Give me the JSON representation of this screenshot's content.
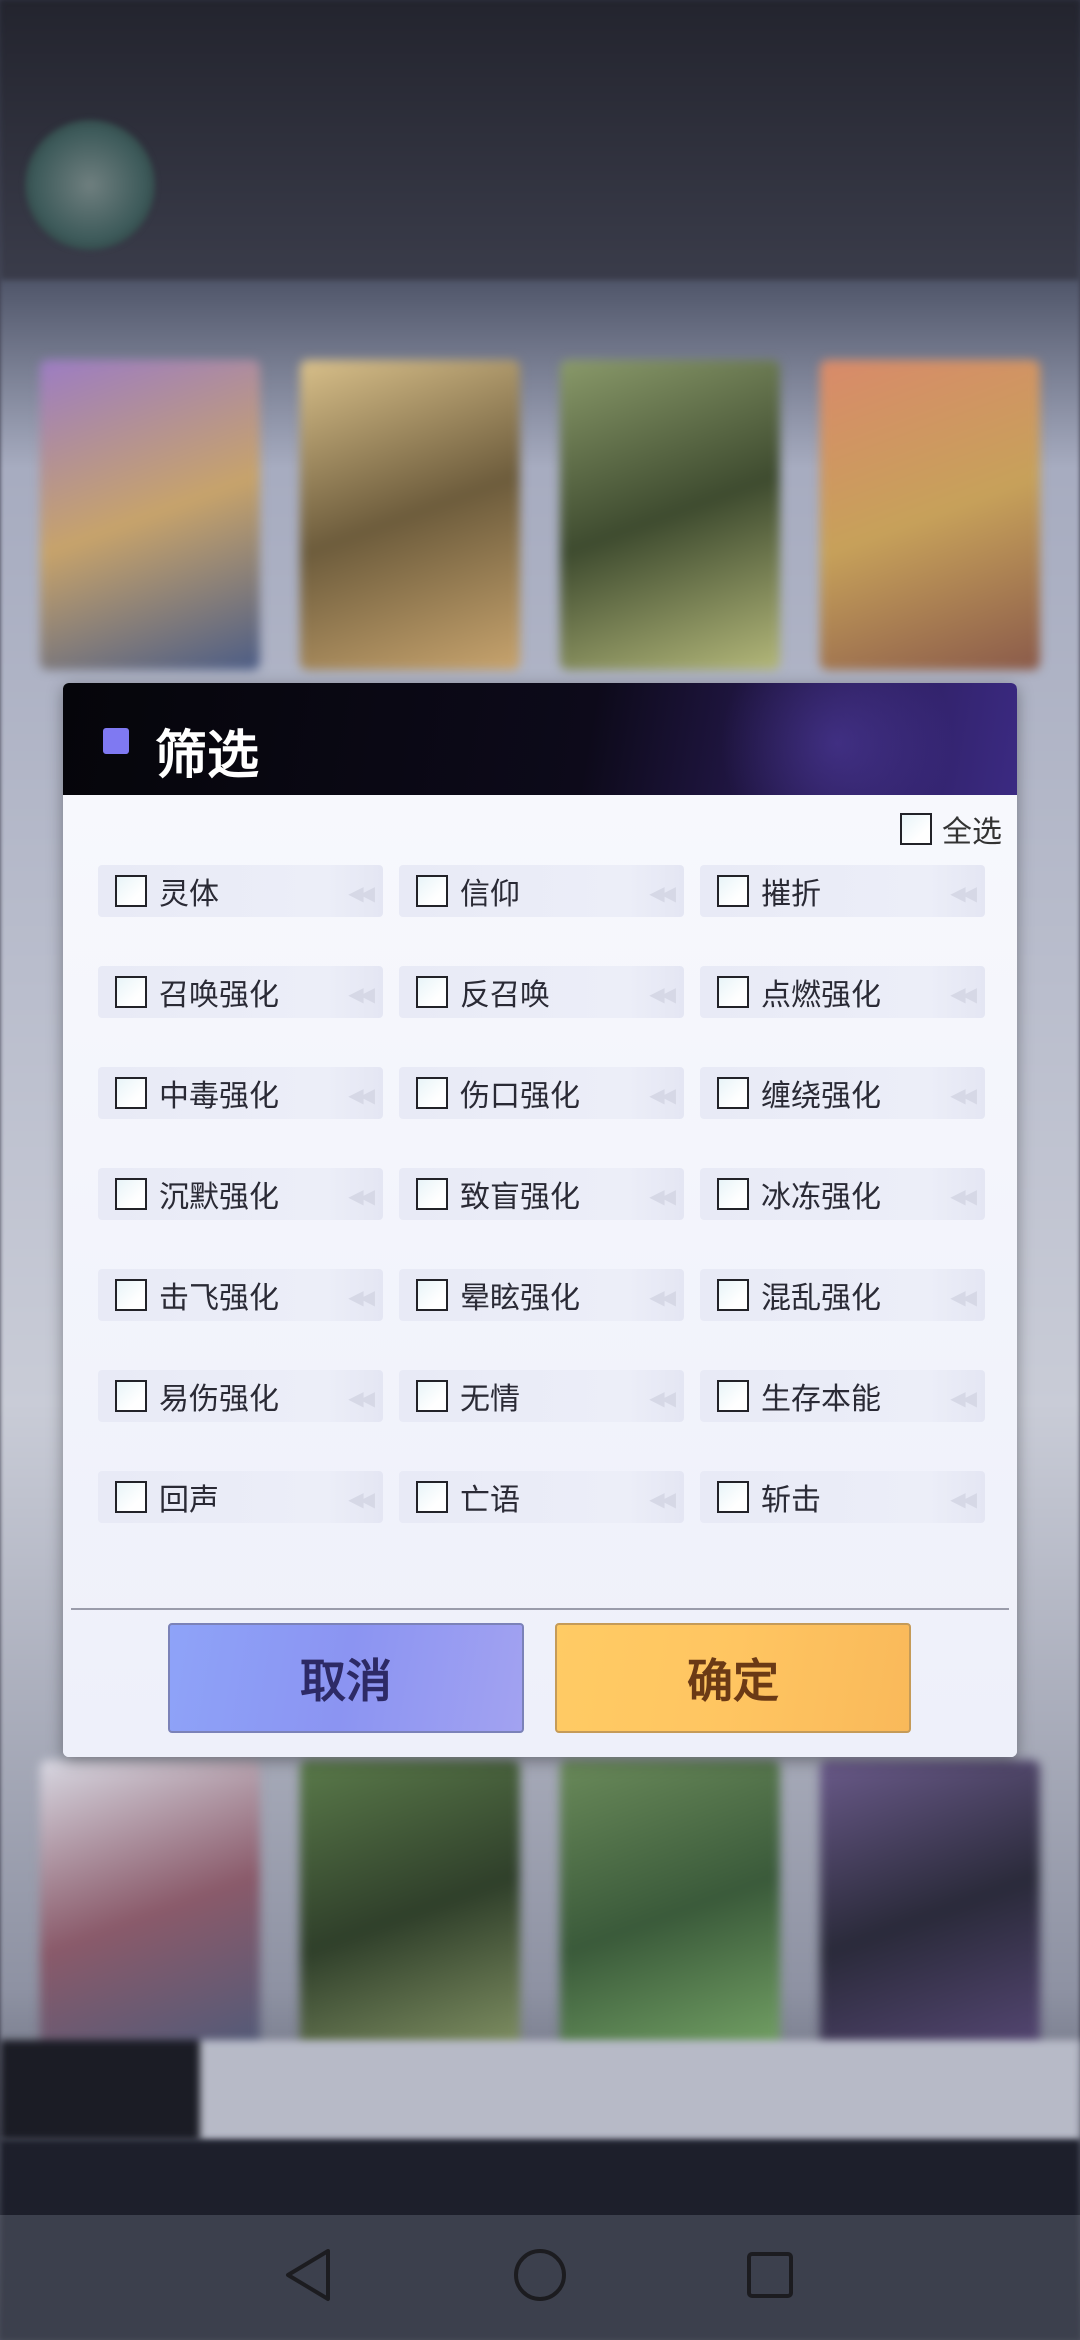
{
  "dialog": {
    "title": "筛选",
    "select_all_label": "全选",
    "options": [
      "灵体",
      "信仰",
      "摧折",
      "召唤强化",
      "反召唤",
      "点燃强化",
      "中毒强化",
      "伤口强化",
      "缠绕强化",
      "沉默强化",
      "致盲强化",
      "冰冻强化",
      "击飞强化",
      "晕眩强化",
      "混乱强化",
      "易伤强化",
      "无情",
      "生存本能",
      "回声",
      "亡语",
      "斩击"
    ],
    "cancel_label": "取消",
    "confirm_label": "确定"
  },
  "navbar": {
    "icons": [
      "back-icon",
      "home-icon",
      "recents-icon"
    ]
  },
  "colors": {
    "header_accent": "#7f79f2",
    "cancel_button": "#8b94f2",
    "confirm_button": "#ffc561"
  }
}
